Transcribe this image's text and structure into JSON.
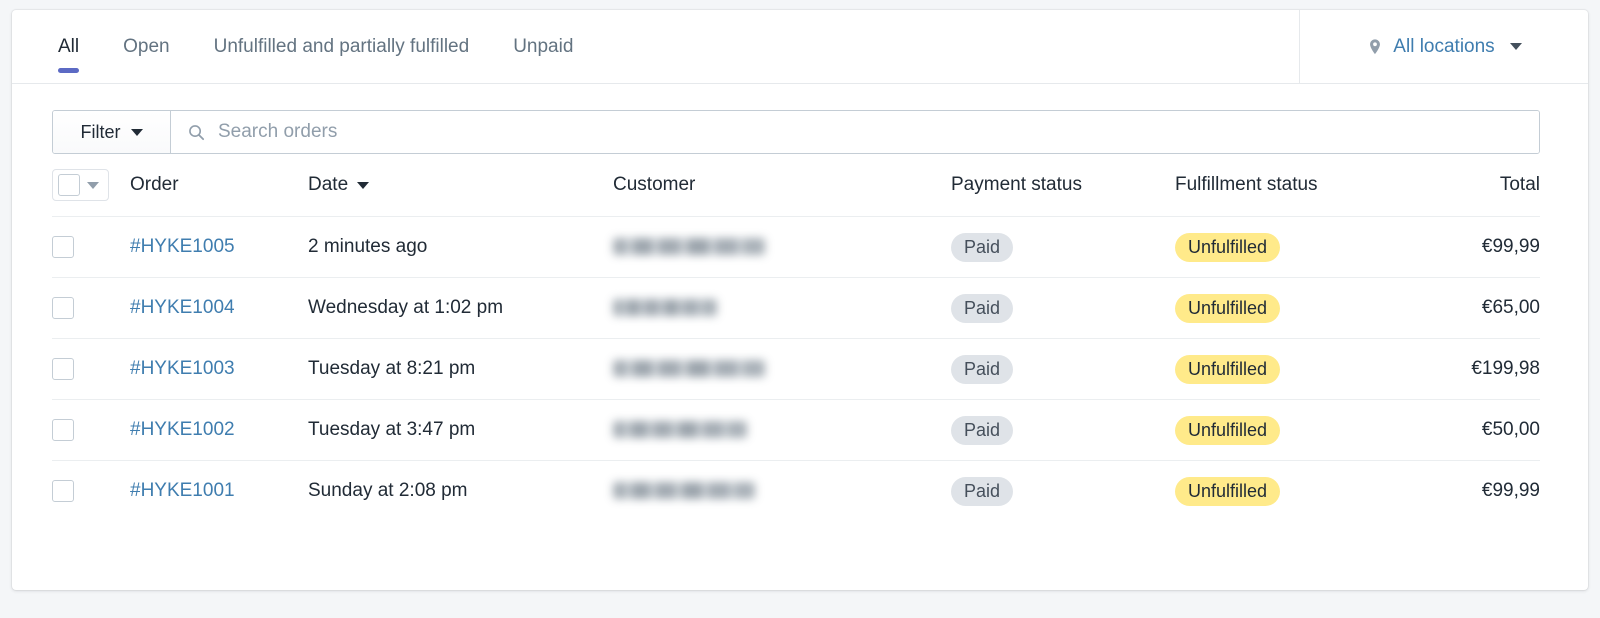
{
  "tabs": [
    {
      "label": "All",
      "active": true
    },
    {
      "label": "Open",
      "active": false
    },
    {
      "label": "Unfulfilled and partially fulfilled",
      "active": false
    },
    {
      "label": "Unpaid",
      "active": false
    }
  ],
  "locations": {
    "label": "All locations",
    "pin_icon": "location-pin-icon",
    "caret_icon": "chevron-down-icon"
  },
  "toolbar": {
    "filter_label": "Filter",
    "filter_caret_icon": "chevron-down-icon",
    "search_placeholder": "Search orders",
    "search_value": "",
    "search_icon": "search-icon"
  },
  "table": {
    "columns": {
      "order": "Order",
      "date": "Date",
      "customer": "Customer",
      "payment_status": "Payment status",
      "fulfillment_status": "Fulfillment status",
      "total": "Total"
    },
    "sort": {
      "column": "Date",
      "caret_icon": "sort-desc-caret-icon"
    },
    "select_all": {
      "checked": false,
      "caret_icon": "chevron-down-icon"
    },
    "rows": [
      {
        "selected": false,
        "order": "#HYKE1005",
        "date": "2 minutes ago",
        "customer_redacted": true,
        "customer_width": 152,
        "payment_status": "Paid",
        "fulfillment_status": "Unfulfilled",
        "total": "€99,99"
      },
      {
        "selected": false,
        "order": "#HYKE1004",
        "date": "Wednesday at 1:02 pm",
        "customer_redacted": true,
        "customer_width": 104,
        "payment_status": "Paid",
        "fulfillment_status": "Unfulfilled",
        "total": "€65,00"
      },
      {
        "selected": false,
        "order": "#HYKE1003",
        "date": "Tuesday at 8:21 pm",
        "customer_redacted": true,
        "customer_width": 152,
        "payment_status": "Paid",
        "fulfillment_status": "Unfulfilled",
        "total": "€199,98"
      },
      {
        "selected": false,
        "order": "#HYKE1002",
        "date": "Tuesday at 3:47 pm",
        "customer_redacted": true,
        "customer_width": 134,
        "payment_status": "Paid",
        "fulfillment_status": "Unfulfilled",
        "total": "€50,00"
      },
      {
        "selected": false,
        "order": "#HYKE1001",
        "date": "Sunday at 2:08 pm",
        "customer_redacted": true,
        "customer_width": 142,
        "payment_status": "Paid",
        "fulfillment_status": "Unfulfilled",
        "total": "€99,99"
      }
    ]
  },
  "colors": {
    "page_background": "#f4f6f8",
    "card_background": "#ffffff",
    "active_tab_underline": "#5c6ac4",
    "link": "#3f7daf",
    "badge_paid_background": "#dfe3e8",
    "badge_unfulfilled_background": "#ffea8a",
    "text_primary": "#212b36",
    "text_subdued": "#637381",
    "border": "#c4cdd5"
  }
}
